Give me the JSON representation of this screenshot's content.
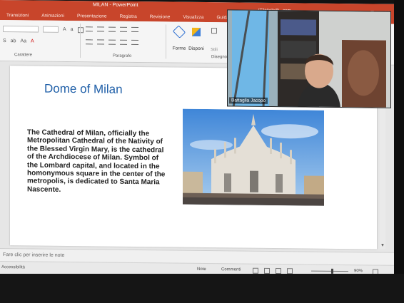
{
  "window": {
    "title": "MILAN - PowerPoint",
    "user": "t72pirolo@...com",
    "controls": [
      "—",
      "▢",
      "✕"
    ]
  },
  "tabs": [
    "Transizioni",
    "Animazioni",
    "Presentazione",
    "Registra",
    "Revisione",
    "Visualizza",
    "Guida"
  ],
  "ribbon": {
    "groups": {
      "characters": "Carattere",
      "paragraph": "Paragrafo",
      "drawing": "Disegno"
    },
    "buttons": {
      "shapes": "Forme",
      "arrange": "Disponi",
      "styles": "Stili"
    }
  },
  "slide": {
    "title": "Dome of Milan",
    "body": "The Cathedral of Milan, officially the Metropolitan Cathedral of the Nativity of the Blessed Virgin Mary, is the cathedral of the Archdiocese of Milan. Symbol of the Lombard capital, and located in the homonymous square in the center of the metropolis, is dedicated to Santa Maria Nascente."
  },
  "notes": {
    "placeholder": "Fare clic per inserire le note"
  },
  "status": {
    "accessibility": "Accessibilità",
    "notes": "Note",
    "comments": "Commenti",
    "zoom": "90%",
    "zoom_level": 0.55
  },
  "webcam": {
    "participant": "Battaglia Jacopo"
  },
  "colors": {
    "accent": "#c8452b",
    "title_blue": "#1f5fa8"
  }
}
